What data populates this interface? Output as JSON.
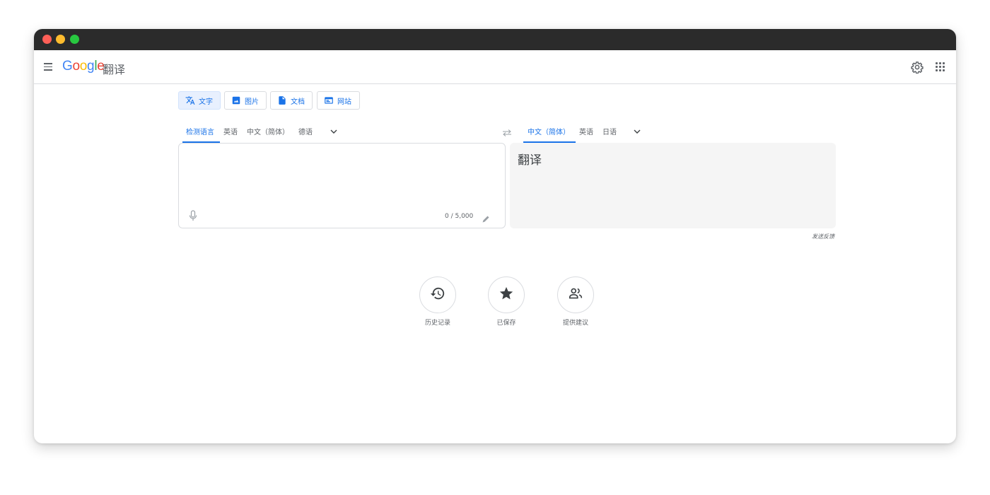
{
  "app": {
    "logo": {
      "G": "G",
      "o1": "o",
      "o2": "o",
      "g": "g",
      "l": "l",
      "e": "e"
    },
    "product_name": "翻译"
  },
  "modes": [
    {
      "label": "文字",
      "icon": "translate-icon",
      "active": true
    },
    {
      "label": "图片",
      "icon": "image-icon",
      "active": false
    },
    {
      "label": "文档",
      "icon": "document-icon",
      "active": false
    },
    {
      "label": "网站",
      "icon": "website-icon",
      "active": false
    }
  ],
  "source_langs": {
    "items": [
      "检测语言",
      "英语",
      "中文（简体）",
      "德语"
    ],
    "active_index": 0
  },
  "target_langs": {
    "items": [
      "中文（简体）",
      "英语",
      "日语"
    ],
    "active_index": 0
  },
  "source": {
    "text": "",
    "counter": "0 / 5,000"
  },
  "target": {
    "text": "翻译",
    "feedback": "发送反馈"
  },
  "actions": [
    {
      "label": "历史记录",
      "icon": "history-icon"
    },
    {
      "label": "已保存",
      "icon": "star-icon"
    },
    {
      "label": "提供建议",
      "icon": "community-icon"
    }
  ],
  "colors": {
    "accent": "#1a73e8",
    "titlebar": "#2b2b2b",
    "target_bg": "#f5f5f5",
    "border": "#dadce0"
  }
}
